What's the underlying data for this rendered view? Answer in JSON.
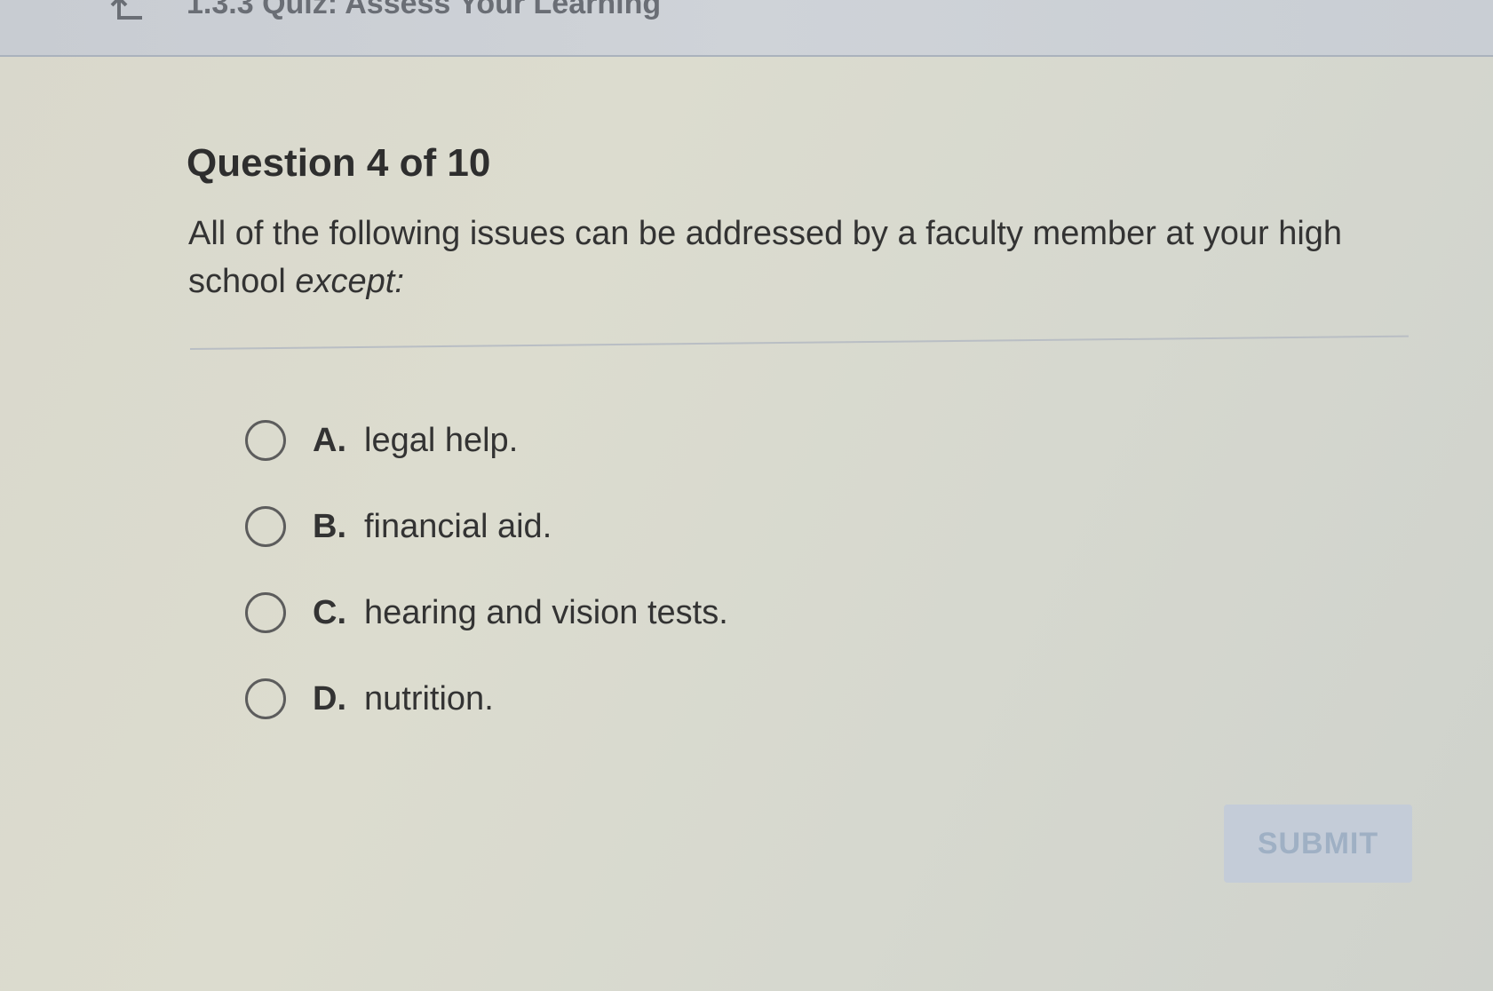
{
  "header": {
    "back_icon": "return-arrow-icon",
    "title": "1.3.3 Quiz: Assess Your Learning"
  },
  "question": {
    "count_label": "Question 4 of 10",
    "text_main": "All of the following issues can be addressed by a faculty member at your high school ",
    "text_emphasis": "except:"
  },
  "options": [
    {
      "letter": "A.",
      "text": "legal help."
    },
    {
      "letter": "B.",
      "text": "financial aid."
    },
    {
      "letter": "C.",
      "text": "hearing and vision tests."
    },
    {
      "letter": "D.",
      "text": "nutrition."
    }
  ],
  "submit": {
    "label": "SUBMIT",
    "enabled": false
  },
  "colors": {
    "page_background": "#d9d9cd",
    "topbar_background": "#cbd0d6",
    "text": "#2e2e2e",
    "submit_disabled_background": "#c4ccd8",
    "submit_disabled_text": "#9fb0c4"
  }
}
